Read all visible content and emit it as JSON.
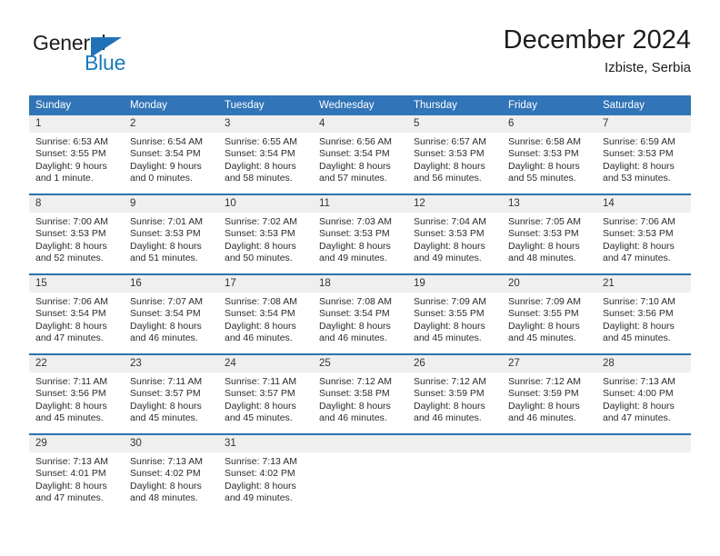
{
  "brand": {
    "name_part1": "General",
    "name_part2": "Blue",
    "triangle_color": "#1f72b8",
    "text_color": "#1d1d1d",
    "blue_color": "#1879bf"
  },
  "header": {
    "title": "December 2024",
    "subtitle": "Izbiste, Serbia"
  },
  "theme": {
    "header_background": "#3174b8",
    "header_text": "#ffffff",
    "daynum_background": "#efefef",
    "row_separator": "#2e72b0",
    "body_text": "#2b2b2b"
  },
  "weekdays": [
    "Sunday",
    "Monday",
    "Tuesday",
    "Wednesday",
    "Thursday",
    "Friday",
    "Saturday"
  ],
  "labels": {
    "sunrise_prefix": "Sunrise:",
    "sunset_prefix": "Sunset:",
    "daylight_prefix": "Daylight:"
  },
  "weeks": [
    [
      {
        "day": "1",
        "sunrise": "Sunrise: 6:53 AM",
        "sunset": "Sunset: 3:55 PM",
        "daylight_line1": "Daylight: 9 hours",
        "daylight_line2": "and 1 minute."
      },
      {
        "day": "2",
        "sunrise": "Sunrise: 6:54 AM",
        "sunset": "Sunset: 3:54 PM",
        "daylight_line1": "Daylight: 9 hours",
        "daylight_line2": "and 0 minutes."
      },
      {
        "day": "3",
        "sunrise": "Sunrise: 6:55 AM",
        "sunset": "Sunset: 3:54 PM",
        "daylight_line1": "Daylight: 8 hours",
        "daylight_line2": "and 58 minutes."
      },
      {
        "day": "4",
        "sunrise": "Sunrise: 6:56 AM",
        "sunset": "Sunset: 3:54 PM",
        "daylight_line1": "Daylight: 8 hours",
        "daylight_line2": "and 57 minutes."
      },
      {
        "day": "5",
        "sunrise": "Sunrise: 6:57 AM",
        "sunset": "Sunset: 3:53 PM",
        "daylight_line1": "Daylight: 8 hours",
        "daylight_line2": "and 56 minutes."
      },
      {
        "day": "6",
        "sunrise": "Sunrise: 6:58 AM",
        "sunset": "Sunset: 3:53 PM",
        "daylight_line1": "Daylight: 8 hours",
        "daylight_line2": "and 55 minutes."
      },
      {
        "day": "7",
        "sunrise": "Sunrise: 6:59 AM",
        "sunset": "Sunset: 3:53 PM",
        "daylight_line1": "Daylight: 8 hours",
        "daylight_line2": "and 53 minutes."
      }
    ],
    [
      {
        "day": "8",
        "sunrise": "Sunrise: 7:00 AM",
        "sunset": "Sunset: 3:53 PM",
        "daylight_line1": "Daylight: 8 hours",
        "daylight_line2": "and 52 minutes."
      },
      {
        "day": "9",
        "sunrise": "Sunrise: 7:01 AM",
        "sunset": "Sunset: 3:53 PM",
        "daylight_line1": "Daylight: 8 hours",
        "daylight_line2": "and 51 minutes."
      },
      {
        "day": "10",
        "sunrise": "Sunrise: 7:02 AM",
        "sunset": "Sunset: 3:53 PM",
        "daylight_line1": "Daylight: 8 hours",
        "daylight_line2": "and 50 minutes."
      },
      {
        "day": "11",
        "sunrise": "Sunrise: 7:03 AM",
        "sunset": "Sunset: 3:53 PM",
        "daylight_line1": "Daylight: 8 hours",
        "daylight_line2": "and 49 minutes."
      },
      {
        "day": "12",
        "sunrise": "Sunrise: 7:04 AM",
        "sunset": "Sunset: 3:53 PM",
        "daylight_line1": "Daylight: 8 hours",
        "daylight_line2": "and 49 minutes."
      },
      {
        "day": "13",
        "sunrise": "Sunrise: 7:05 AM",
        "sunset": "Sunset: 3:53 PM",
        "daylight_line1": "Daylight: 8 hours",
        "daylight_line2": "and 48 minutes."
      },
      {
        "day": "14",
        "sunrise": "Sunrise: 7:06 AM",
        "sunset": "Sunset: 3:53 PM",
        "daylight_line1": "Daylight: 8 hours",
        "daylight_line2": "and 47 minutes."
      }
    ],
    [
      {
        "day": "15",
        "sunrise": "Sunrise: 7:06 AM",
        "sunset": "Sunset: 3:54 PM",
        "daylight_line1": "Daylight: 8 hours",
        "daylight_line2": "and 47 minutes."
      },
      {
        "day": "16",
        "sunrise": "Sunrise: 7:07 AM",
        "sunset": "Sunset: 3:54 PM",
        "daylight_line1": "Daylight: 8 hours",
        "daylight_line2": "and 46 minutes."
      },
      {
        "day": "17",
        "sunrise": "Sunrise: 7:08 AM",
        "sunset": "Sunset: 3:54 PM",
        "daylight_line1": "Daylight: 8 hours",
        "daylight_line2": "and 46 minutes."
      },
      {
        "day": "18",
        "sunrise": "Sunrise: 7:08 AM",
        "sunset": "Sunset: 3:54 PM",
        "daylight_line1": "Daylight: 8 hours",
        "daylight_line2": "and 46 minutes."
      },
      {
        "day": "19",
        "sunrise": "Sunrise: 7:09 AM",
        "sunset": "Sunset: 3:55 PM",
        "daylight_line1": "Daylight: 8 hours",
        "daylight_line2": "and 45 minutes."
      },
      {
        "day": "20",
        "sunrise": "Sunrise: 7:09 AM",
        "sunset": "Sunset: 3:55 PM",
        "daylight_line1": "Daylight: 8 hours",
        "daylight_line2": "and 45 minutes."
      },
      {
        "day": "21",
        "sunrise": "Sunrise: 7:10 AM",
        "sunset": "Sunset: 3:56 PM",
        "daylight_line1": "Daylight: 8 hours",
        "daylight_line2": "and 45 minutes."
      }
    ],
    [
      {
        "day": "22",
        "sunrise": "Sunrise: 7:11 AM",
        "sunset": "Sunset: 3:56 PM",
        "daylight_line1": "Daylight: 8 hours",
        "daylight_line2": "and 45 minutes."
      },
      {
        "day": "23",
        "sunrise": "Sunrise: 7:11 AM",
        "sunset": "Sunset: 3:57 PM",
        "daylight_line1": "Daylight: 8 hours",
        "daylight_line2": "and 45 minutes."
      },
      {
        "day": "24",
        "sunrise": "Sunrise: 7:11 AM",
        "sunset": "Sunset: 3:57 PM",
        "daylight_line1": "Daylight: 8 hours",
        "daylight_line2": "and 45 minutes."
      },
      {
        "day": "25",
        "sunrise": "Sunrise: 7:12 AM",
        "sunset": "Sunset: 3:58 PM",
        "daylight_line1": "Daylight: 8 hours",
        "daylight_line2": "and 46 minutes."
      },
      {
        "day": "26",
        "sunrise": "Sunrise: 7:12 AM",
        "sunset": "Sunset: 3:59 PM",
        "daylight_line1": "Daylight: 8 hours",
        "daylight_line2": "and 46 minutes."
      },
      {
        "day": "27",
        "sunrise": "Sunrise: 7:12 AM",
        "sunset": "Sunset: 3:59 PM",
        "daylight_line1": "Daylight: 8 hours",
        "daylight_line2": "and 46 minutes."
      },
      {
        "day": "28",
        "sunrise": "Sunrise: 7:13 AM",
        "sunset": "Sunset: 4:00 PM",
        "daylight_line1": "Daylight: 8 hours",
        "daylight_line2": "and 47 minutes."
      }
    ],
    [
      {
        "day": "29",
        "sunrise": "Sunrise: 7:13 AM",
        "sunset": "Sunset: 4:01 PM",
        "daylight_line1": "Daylight: 8 hours",
        "daylight_line2": "and 47 minutes."
      },
      {
        "day": "30",
        "sunrise": "Sunrise: 7:13 AM",
        "sunset": "Sunset: 4:02 PM",
        "daylight_line1": "Daylight: 8 hours",
        "daylight_line2": "and 48 minutes."
      },
      {
        "day": "31",
        "sunrise": "Sunrise: 7:13 AM",
        "sunset": "Sunset: 4:02 PM",
        "daylight_line1": "Daylight: 8 hours",
        "daylight_line2": "and 49 minutes."
      },
      {
        "day": "",
        "sunrise": "",
        "sunset": "",
        "daylight_line1": "",
        "daylight_line2": ""
      },
      {
        "day": "",
        "sunrise": "",
        "sunset": "",
        "daylight_line1": "",
        "daylight_line2": ""
      },
      {
        "day": "",
        "sunrise": "",
        "sunset": "",
        "daylight_line1": "",
        "daylight_line2": ""
      },
      {
        "day": "",
        "sunrise": "",
        "sunset": "",
        "daylight_line1": "",
        "daylight_line2": ""
      }
    ]
  ]
}
